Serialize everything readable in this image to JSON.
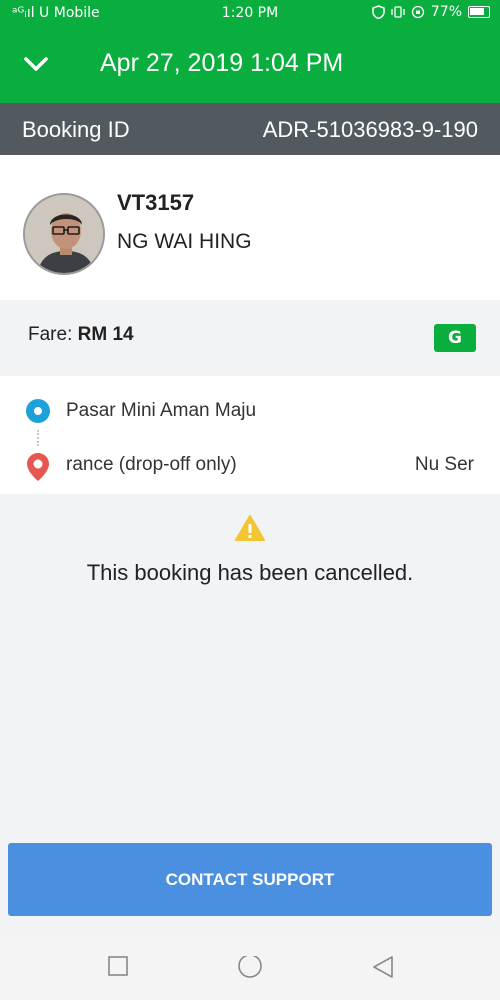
{
  "status_bar": {
    "carrier": "ᵃᴳᵢıl U Mobile",
    "time": "1:20 PM",
    "battery": "77%"
  },
  "header": {
    "back_icon": "chevron-down-icon",
    "title": "Apr 27, 2019 1:04 PM"
  },
  "booking": {
    "label": "Booking ID",
    "id": "ADR-51036983-9-190"
  },
  "driver": {
    "plate": "VT3157",
    "name": "NG WAI HING"
  },
  "fare": {
    "label": "Fare:",
    "amount": "RM 14",
    "badge": "G"
  },
  "route": {
    "pickup": "Pasar Mini Aman Maju",
    "dropoff": "rance (drop-off only)",
    "dropoff_right": "Nu Ser"
  },
  "cancel": {
    "message": "This booking has been cancelled."
  },
  "support_button": "CONTACT SUPPORT",
  "colors": {
    "brand": "#0aae3e",
    "bar": "#525a60",
    "button": "#4a8fe0",
    "pickup": "#1ea0d9",
    "dropoff": "#e8574f",
    "warning": "#f3c532"
  }
}
